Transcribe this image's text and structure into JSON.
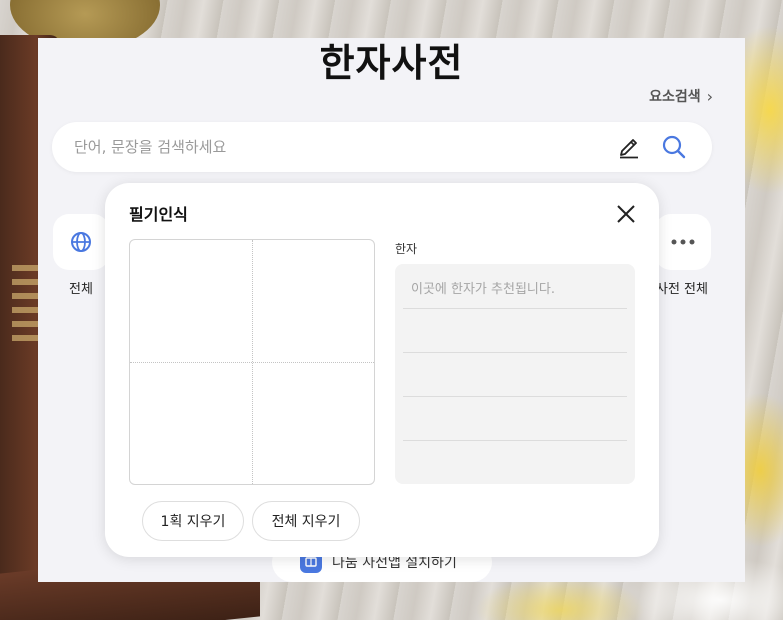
{
  "page": {
    "title": "한자사전",
    "element_search_label": "요소검색"
  },
  "search": {
    "placeholder": "단어, 문장을 검색하세요",
    "value": ""
  },
  "categories": [
    {
      "label": "전체",
      "icon": "globe-icon"
    },
    {
      "label": "사전 전체",
      "icon": "more-dots-icon"
    }
  ],
  "install_app": {
    "label": "나눔 사전앱 설치하기"
  },
  "handwriting_popup": {
    "title": "필기인식",
    "result_label": "한자",
    "result_placeholder": "이곳에 한자가 추천됩니다.",
    "undo_stroke_label": "1획 지우기",
    "clear_all_label": "전체 지우기"
  },
  "colors": {
    "accent_blue": "#4a78e0",
    "panel_bg": "#f3f3f7",
    "candidate_bg": "#f3f3f3"
  }
}
